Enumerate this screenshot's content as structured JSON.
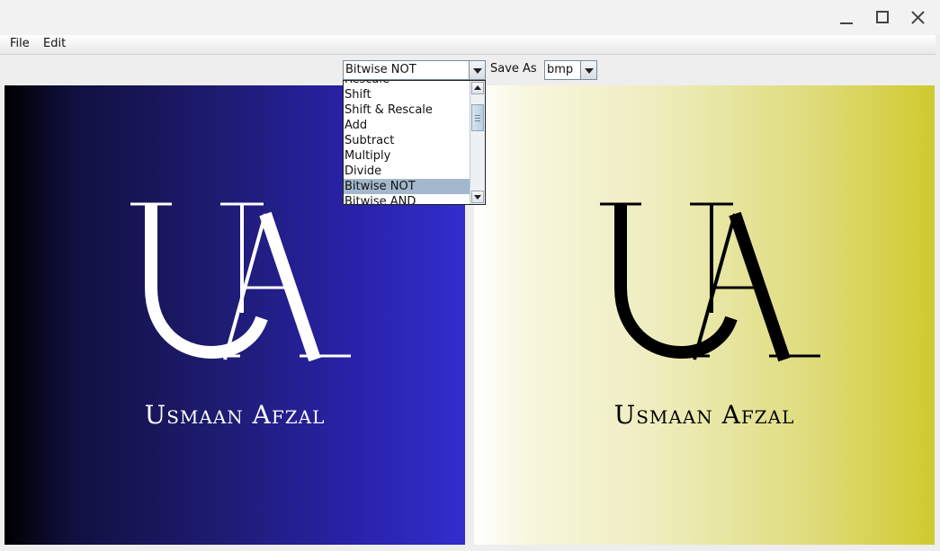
{
  "window": {
    "controls": {
      "minimize_icon": "minimize-icon",
      "maximize_icon": "maximize-icon",
      "close_icon": "close-icon"
    }
  },
  "menubar": {
    "items": [
      {
        "label": "File"
      },
      {
        "label": "Edit"
      }
    ]
  },
  "toolbar": {
    "operation_selected": "Bitwise NOT",
    "save_as_label": "Save As",
    "format_selected": "bmp"
  },
  "dropdown": {
    "items": [
      {
        "label": "Rescale"
      },
      {
        "label": "Shift"
      },
      {
        "label": "Shift & Rescale"
      },
      {
        "label": "Add"
      },
      {
        "label": "Subtract"
      },
      {
        "label": "Multiply"
      },
      {
        "label": "Divide"
      },
      {
        "label": "Bitwise NOT"
      },
      {
        "label": "Bitwise AND"
      }
    ],
    "selected_index": 7
  },
  "images": {
    "original": {
      "caption": "Usmaan Afzal",
      "monogram": "UA",
      "text_color": "#ffffff"
    },
    "processed": {
      "caption": "Usmaan Afzal",
      "monogram": "UA",
      "text_color": "#000000"
    }
  }
}
